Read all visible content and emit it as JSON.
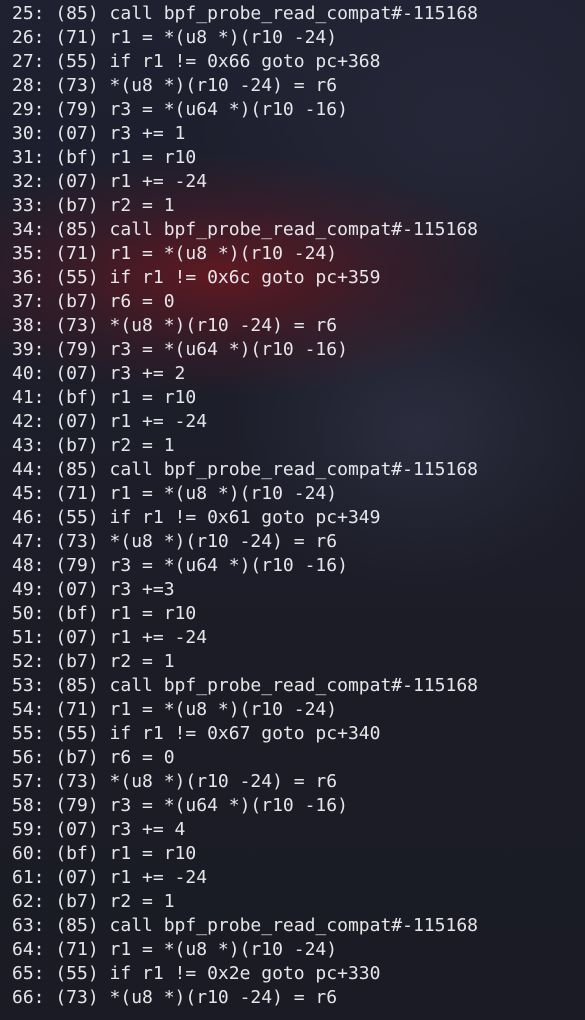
{
  "terminal": {
    "lines": [
      "25: (85) call bpf_probe_read_compat#-115168",
      "26: (71) r1 = *(u8 *)(r10 -24)",
      "27: (55) if r1 != 0x66 goto pc+368",
      "28: (73) *(u8 *)(r10 -24) = r6",
      "29: (79) r3 = *(u64 *)(r10 -16)",
      "30: (07) r3 += 1",
      "31: (bf) r1 = r10",
      "32: (07) r1 += -24",
      "33: (b7) r2 = 1",
      "34: (85) call bpf_probe_read_compat#-115168",
      "35: (71) r1 = *(u8 *)(r10 -24)",
      "36: (55) if r1 != 0x6c goto pc+359",
      "37: (b7) r6 = 0",
      "38: (73) *(u8 *)(r10 -24) = r6",
      "39: (79) r3 = *(u64 *)(r10 -16)",
      "40: (07) r3 += 2",
      "41: (bf) r1 = r10",
      "42: (07) r1 += -24",
      "43: (b7) r2 = 1",
      "44: (85) call bpf_probe_read_compat#-115168",
      "45: (71) r1 = *(u8 *)(r10 -24)",
      "46: (55) if r1 != 0x61 goto pc+349",
      "47: (73) *(u8 *)(r10 -24) = r6",
      "48: (79) r3 = *(u64 *)(r10 -16)",
      "49: (07) r3 +=3",
      "50: (bf) r1 = r10",
      "51: (07) r1 += -24",
      "52: (b7) r2 = 1",
      "53: (85) call bpf_probe_read_compat#-115168",
      "54: (71) r1 = *(u8 *)(r10 -24)",
      "55: (55) if r1 != 0x67 goto pc+340",
      "56: (b7) r6 = 0",
      "57: (73) *(u8 *)(r10 -24) = r6",
      "58: (79) r3 = *(u64 *)(r10 -16)",
      "59: (07) r3 += 4",
      "60: (bf) r1 = r10",
      "61: (07) r1 += -24",
      "62: (b7) r2 = 1",
      "63: (85) call bpf_probe_read_compat#-115168",
      "64: (71) r1 = *(u8 *)(r10 -24)",
      "65: (55) if r1 != 0x2e goto pc+330",
      "66: (73) *(u8 *)(r10 -24) = r6"
    ]
  }
}
